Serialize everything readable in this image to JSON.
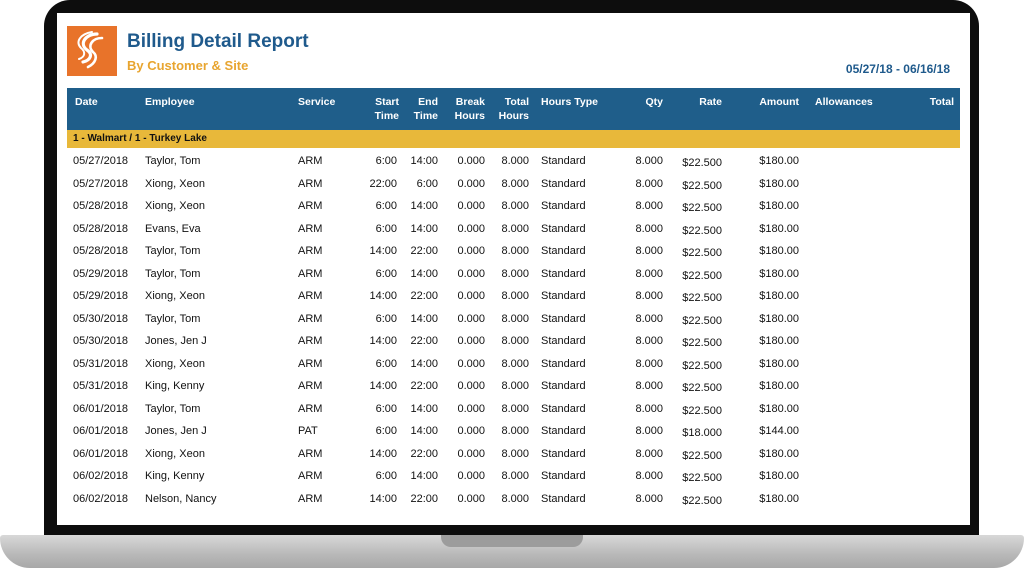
{
  "report": {
    "title": "Billing Detail Report",
    "subtitle": "By Customer & Site",
    "date_range": "05/27/18 - 06/16/18"
  },
  "columns": {
    "date": "Date",
    "employee": "Employee",
    "service": "Service",
    "start_time": [
      "Start",
      "Time"
    ],
    "end_time": [
      "End",
      "Time"
    ],
    "break_hours": [
      "Break",
      "Hours"
    ],
    "total_hours": [
      "Total",
      "Hours"
    ],
    "hours_type": "Hours Type",
    "qty": "Qty",
    "rate": "Rate",
    "amount": "Amount",
    "allowances": "Allowances",
    "total": "Total"
  },
  "group": {
    "label": "1 - Walmart / 1 - Turkey Lake"
  },
  "rows": [
    {
      "date": "05/27/2018",
      "employee": "Taylor, Tom",
      "service": "ARM",
      "start": "6:00",
      "end": "14:00",
      "break": "0.000",
      "total_hours": "8.000",
      "type": "Standard",
      "qty": "8.000",
      "rate": "$22.500",
      "amount": "$180.00"
    },
    {
      "date": "05/27/2018",
      "employee": "Xiong, Xeon",
      "service": "ARM",
      "start": "22:00",
      "end": "6:00",
      "break": "0.000",
      "total_hours": "8.000",
      "type": "Standard",
      "qty": "8.000",
      "rate": "$22.500",
      "amount": "$180.00"
    },
    {
      "date": "05/28/2018",
      "employee": "Xiong, Xeon",
      "service": "ARM",
      "start": "6:00",
      "end": "14:00",
      "break": "0.000",
      "total_hours": "8.000",
      "type": "Standard",
      "qty": "8.000",
      "rate": "$22.500",
      "amount": "$180.00"
    },
    {
      "date": "05/28/2018",
      "employee": "Evans, Eva",
      "service": "ARM",
      "start": "6:00",
      "end": "14:00",
      "break": "0.000",
      "total_hours": "8.000",
      "type": "Standard",
      "qty": "8.000",
      "rate": "$22.500",
      "amount": "$180.00"
    },
    {
      "date": "05/28/2018",
      "employee": "Taylor, Tom",
      "service": "ARM",
      "start": "14:00",
      "end": "22:00",
      "break": "0.000",
      "total_hours": "8.000",
      "type": "Standard",
      "qty": "8.000",
      "rate": "$22.500",
      "amount": "$180.00"
    },
    {
      "date": "05/29/2018",
      "employee": "Taylor, Tom",
      "service": "ARM",
      "start": "6:00",
      "end": "14:00",
      "break": "0.000",
      "total_hours": "8.000",
      "type": "Standard",
      "qty": "8.000",
      "rate": "$22.500",
      "amount": "$180.00"
    },
    {
      "date": "05/29/2018",
      "employee": "Xiong, Xeon",
      "service": "ARM",
      "start": "14:00",
      "end": "22:00",
      "break": "0.000",
      "total_hours": "8.000",
      "type": "Standard",
      "qty": "8.000",
      "rate": "$22.500",
      "amount": "$180.00"
    },
    {
      "date": "05/30/2018",
      "employee": "Taylor, Tom",
      "service": "ARM",
      "start": "6:00",
      "end": "14:00",
      "break": "0.000",
      "total_hours": "8.000",
      "type": "Standard",
      "qty": "8.000",
      "rate": "$22.500",
      "amount": "$180.00"
    },
    {
      "date": "05/30/2018",
      "employee": "Jones, Jen J",
      "service": "ARM",
      "start": "14:00",
      "end": "22:00",
      "break": "0.000",
      "total_hours": "8.000",
      "type": "Standard",
      "qty": "8.000",
      "rate": "$22.500",
      "amount": "$180.00"
    },
    {
      "date": "05/31/2018",
      "employee": "Xiong, Xeon",
      "service": "ARM",
      "start": "6:00",
      "end": "14:00",
      "break": "0.000",
      "total_hours": "8.000",
      "type": "Standard",
      "qty": "8.000",
      "rate": "$22.500",
      "amount": "$180.00"
    },
    {
      "date": "05/31/2018",
      "employee": "King, Kenny",
      "service": "ARM",
      "start": "14:00",
      "end": "22:00",
      "break": "0.000",
      "total_hours": "8.000",
      "type": "Standard",
      "qty": "8.000",
      "rate": "$22.500",
      "amount": "$180.00"
    },
    {
      "date": "06/01/2018",
      "employee": "Taylor, Tom",
      "service": "ARM",
      "start": "6:00",
      "end": "14:00",
      "break": "0.000",
      "total_hours": "8.000",
      "type": "Standard",
      "qty": "8.000",
      "rate": "$22.500",
      "amount": "$180.00"
    },
    {
      "date": "06/01/2018",
      "employee": "Jones, Jen J",
      "service": "PAT",
      "start": "6:00",
      "end": "14:00",
      "break": "0.000",
      "total_hours": "8.000",
      "type": "Standard",
      "qty": "8.000",
      "rate": "$18.000",
      "amount": "$144.00"
    },
    {
      "date": "06/01/2018",
      "employee": "Xiong, Xeon",
      "service": "ARM",
      "start": "14:00",
      "end": "22:00",
      "break": "0.000",
      "total_hours": "8.000",
      "type": "Standard",
      "qty": "8.000",
      "rate": "$22.500",
      "amount": "$180.00"
    },
    {
      "date": "06/02/2018",
      "employee": "King, Kenny",
      "service": "ARM",
      "start": "6:00",
      "end": "14:00",
      "break": "0.000",
      "total_hours": "8.000",
      "type": "Standard",
      "qty": "8.000",
      "rate": "$22.500",
      "amount": "$180.00"
    },
    {
      "date": "06/02/2018",
      "employee": "Nelson, Nancy",
      "service": "ARM",
      "start": "14:00",
      "end": "22:00",
      "break": "0.000",
      "total_hours": "8.000",
      "type": "Standard",
      "qty": "8.000",
      "rate": "$22.500",
      "amount": "$180.00"
    }
  ],
  "icons": {
    "logo": "company-swirl-logo"
  },
  "colors": {
    "header_bg": "#1f5e8a",
    "title": "#1f5a8c",
    "subtitle": "#e8a530",
    "group_bar": "#e8b83a",
    "logo_bg": "#e8732a"
  }
}
